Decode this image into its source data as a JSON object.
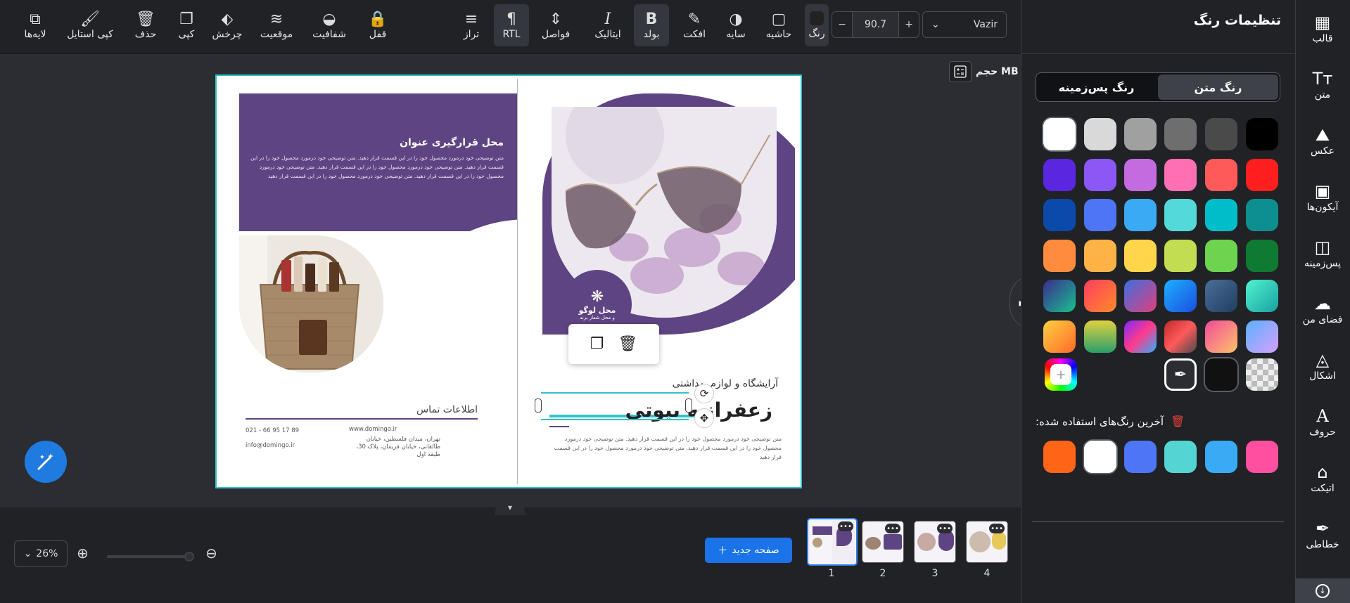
{
  "toolbar": {
    "layers": "لایه‌ها",
    "copy_style": "کپی استایل",
    "delete": "حذف",
    "copy": "کپی",
    "rotate": "چرخش",
    "position": "موقعیت",
    "opacity": "شفافیت",
    "lock": "قفل",
    "align": "تراز",
    "rtl": "RTL",
    "spacing": "فواصل",
    "italic": "ایتالیک",
    "bold": "بولد",
    "effect": "افکت",
    "shadow": "سایه",
    "border": "حاشیه",
    "color": "رنگ",
    "font_size": "90.7",
    "font_family": "Vazir"
  },
  "canvas": {
    "size_label": "حجم MB",
    "left_title": "محل قرارگیری عنوان",
    "left_body": "متن توضیحی خود درمورد محصول خود را در این قسمت قرار دهید. متن توضیحی خود درمورد محصول خود را در این قسمت قرار دهید. متن توضیحی خود درمورد محصول خود را در این قسمت قرار دهید. متن توضیحی خود درمورد محصول خود را در این قسمت قرار دهید. متن توضیحی خود درمورد محصول خود را در این قسمت قرار دهید",
    "logo_title": "محل لوگو",
    "logo_sub": "و محل شعار برند",
    "contact_title": "اطلاعات تماس",
    "phone": "021 - 66 95 17 89",
    "email": "info@domingo.ir",
    "website": "www.domingo.ir",
    "address": "تهران، میدان فلسطین، خیابان طالقانی، خیابان فریمان، پلاک 30، طبقه اول",
    "sub_title": "آرایشگاه و لوازم بهداشتی",
    "main_title": "زعفرانیه بیوتی",
    "right_body": "متن توضیحی خود درمورد محصول خود را در این قسمت قرار دهید. متن توضیحی خود درمورد محصول خود را در این قسمت قرار دهید. متن توضیحی خود درمورد محصول خود را در این قسمت قرار دهید"
  },
  "bottom": {
    "zoom": "26%",
    "new_page": "صفحه جدید",
    "pages": [
      "1",
      "2",
      "3",
      "4"
    ],
    "selected_page": "1"
  },
  "panel": {
    "title": "تنظیمات رنگ",
    "tab_text_color": "رنگ متن",
    "tab_bg_color": "رنگ پس‌زمینه",
    "recent_title": "آخرین رنگ‌های استفاده شده:",
    "palette_rows": [
      [
        "#000000",
        "#4a4a4a",
        "#6e6e6e",
        "#a0a0a0",
        "#d9d9d9",
        "#ffffff"
      ],
      [
        "#ff1f1f",
        "#ff5a5a",
        "#ff6fb4",
        "#c46be0",
        "#8b57f5",
        "#5a26e0"
      ],
      [
        "#0e8f8f",
        "#00bec9",
        "#54d9d9",
        "#3aaaf5",
        "#4e75f5",
        "#0b4aa8"
      ],
      [
        "#0f7a32",
        "#6dd44f",
        "#c2dd52",
        "#ffd64a",
        "#ffb347",
        "#ff8c3e"
      ]
    ],
    "recent_colors": [
      "#ff4fa0",
      "#3aaaf5",
      "#55d4d4",
      "#4e75f5",
      "#ffffff",
      "#ff6417"
    ]
  },
  "nav": {
    "template": "قالب",
    "text": "متن",
    "photo": "عکس",
    "icons": "آیکون‌ها",
    "background": "پس‌زمینه",
    "my_space": "فضای من",
    "shapes": "اشکال",
    "letters": "حروف",
    "sticker": "اتیکت",
    "calligraphy": "خطاطی"
  }
}
